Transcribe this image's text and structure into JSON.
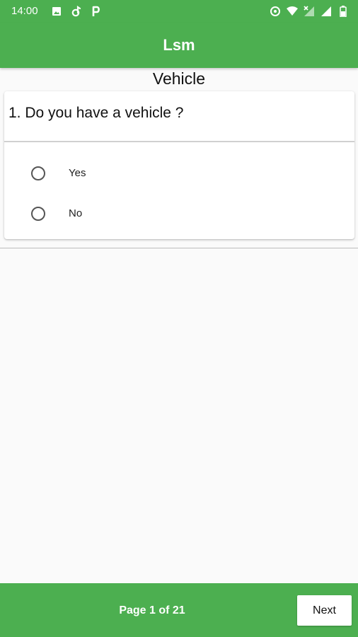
{
  "status_bar": {
    "time": "14:00",
    "left_icons": [
      "image-icon",
      "rocket-d-icon",
      "parking-p-icon"
    ],
    "right_icons": [
      "data-saver-icon",
      "wifi-icon",
      "signal-x-icon",
      "signal-icon",
      "battery-icon"
    ]
  },
  "app_bar": {
    "title": "Lsm"
  },
  "section": {
    "title": "Vehicle"
  },
  "question": {
    "text": "1. Do you have a vehicle ?",
    "options": [
      {
        "label": "Yes",
        "selected": false
      },
      {
        "label": "No",
        "selected": false
      }
    ]
  },
  "footer": {
    "page_indicator": "Page 1 of 21",
    "next_label": "Next"
  },
  "colors": {
    "primary": "#4caf50",
    "background": "#fafafa",
    "card": "#ffffff"
  }
}
